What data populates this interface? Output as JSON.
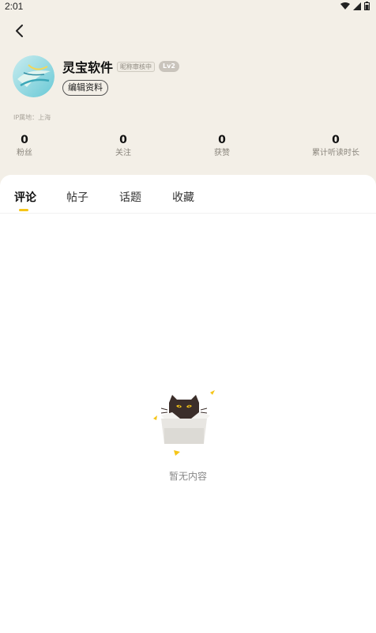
{
  "status_bar": {
    "time": "2:01",
    "icons": [
      "wifi-icon",
      "signal-icon",
      "battery-icon"
    ]
  },
  "header": {
    "back_icon": "chevron-left-icon"
  },
  "profile": {
    "avatar_icon": "avatar-image",
    "username": "灵宝软件",
    "review_badge": "昵称审核中",
    "level_badge": "Lv2",
    "edit_button": "编辑资料",
    "ip_location": "IP属地：上海"
  },
  "stats": [
    {
      "value": "0",
      "label": "粉丝"
    },
    {
      "value": "0",
      "label": "关注"
    },
    {
      "value": "0",
      "label": "获赞"
    },
    {
      "value": "0",
      "label": "累计听读时长"
    }
  ],
  "tabs": [
    {
      "label": "评论",
      "active": true
    },
    {
      "label": "帖子",
      "active": false
    },
    {
      "label": "话题",
      "active": false
    },
    {
      "label": "收藏",
      "active": false
    }
  ],
  "empty_state": {
    "icon": "cat-in-box-icon",
    "text": "暂无内容"
  },
  "colors": {
    "header_bg": "#f3efe7",
    "accent": "#f5c518",
    "panel_bg": "#ffffff"
  }
}
